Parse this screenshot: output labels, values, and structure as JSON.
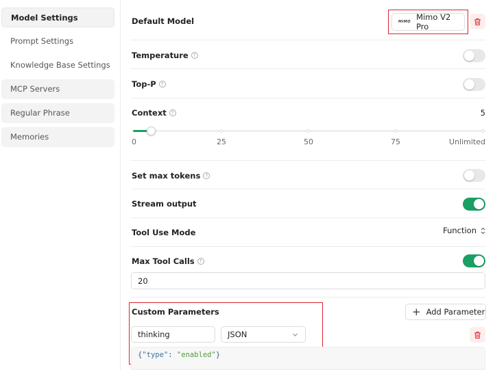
{
  "sidebar": {
    "items": [
      {
        "label": "Model Settings"
      },
      {
        "label": "Prompt Settings"
      },
      {
        "label": "Knowledge Base Settings"
      },
      {
        "label": "MCP Servers"
      },
      {
        "label": "Regular Phrase"
      },
      {
        "label": "Memories"
      }
    ]
  },
  "default_model": {
    "label": "Default Model",
    "logo_text": "MIMO",
    "value": "Mimo V2 Pro"
  },
  "temperature": {
    "label": "Temperature",
    "enabled": false
  },
  "top_p": {
    "label": "Top-P",
    "enabled": false
  },
  "context": {
    "label": "Context",
    "value": "5",
    "ticks": [
      "0",
      "25",
      "50",
      "75",
      "Unlimited"
    ]
  },
  "max_tokens": {
    "label": "Set max tokens",
    "enabled": false
  },
  "stream_output": {
    "label": "Stream output",
    "enabled": true
  },
  "tool_use_mode": {
    "label": "Tool Use Mode",
    "value": "Function"
  },
  "max_tool_calls": {
    "label": "Max Tool Calls",
    "enabled": true,
    "value": "20"
  },
  "custom_parameters": {
    "label": "Custom Parameters",
    "add_button": "Add Parameter",
    "param_name": "thinking",
    "param_type": "JSON",
    "code_open": "{",
    "code_key": "\"type\"",
    "code_colon": ": ",
    "code_value": "\"enabled\"",
    "code_close": "}"
  },
  "colors": {
    "accent_green": "#1aa064",
    "danger_red": "#d9232d"
  }
}
